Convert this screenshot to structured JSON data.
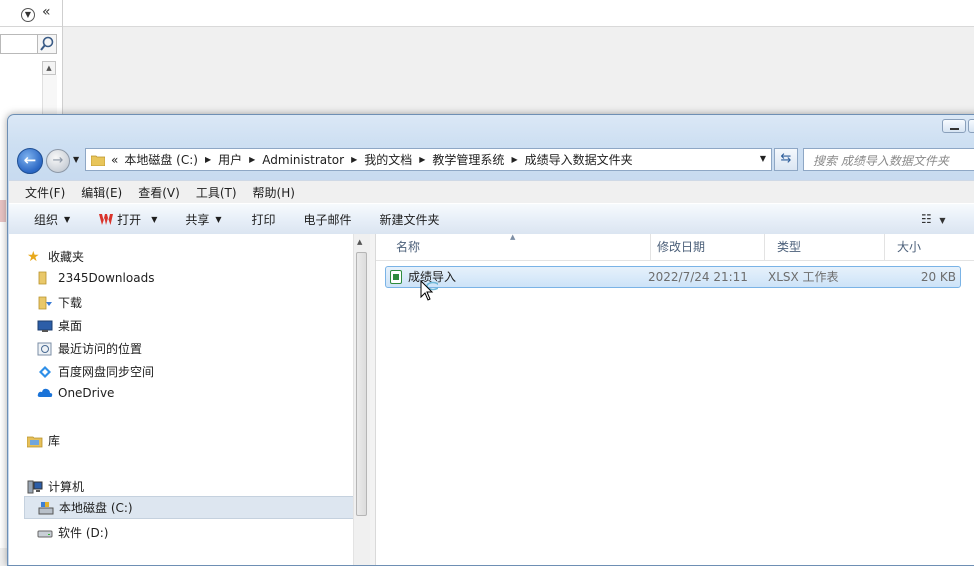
{
  "address_bar": {
    "crumbs": [
      "本地磁盘 (C:)",
      "用户",
      "Administrator",
      "我的文档",
      "教学管理系统",
      "成绩导入数据文件夹"
    ]
  },
  "search": {
    "placeholder": "搜索 成绩导入数据文件夹"
  },
  "menubar": [
    "文件(F)",
    "编辑(E)",
    "查看(V)",
    "工具(T)",
    "帮助(H)"
  ],
  "toolbar": {
    "organize": "组织",
    "open": "打开",
    "share": "共享",
    "print": "打印",
    "email": "电子邮件",
    "new_folder": "新建文件夹"
  },
  "nav": {
    "favorites": "收藏夹",
    "downloads_2345": "2345Downloads",
    "downloads": "下载",
    "desktop": "桌面",
    "recent": "最近访问的位置",
    "baidu": "百度网盘同步空间",
    "onedrive": "OneDrive",
    "libraries": "库",
    "computer": "计算机",
    "drive_c": "本地磁盘 (C:)",
    "drive_d": "软件 (D:)"
  },
  "columns": {
    "name": "名称",
    "modified": "修改日期",
    "type": "类型",
    "size": "大小"
  },
  "files": [
    {
      "name": "成绩导入",
      "modified": "2022/7/24 21:11",
      "type": "XLSX 工作表",
      "size": "20 KB"
    }
  ],
  "colors": {
    "selection": "#cde3f8",
    "selection_border": "#7ab3e6",
    "frame": "#c6d9ef"
  }
}
